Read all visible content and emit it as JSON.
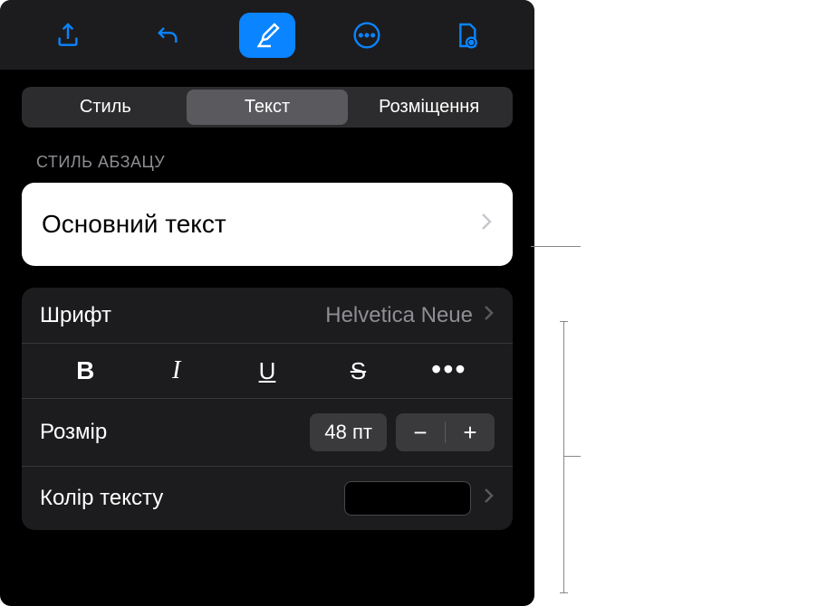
{
  "toolbar": {
    "icons": [
      "share",
      "undo",
      "format",
      "more",
      "document"
    ]
  },
  "tabs": {
    "style": "Стиль",
    "text": "Текст",
    "layout": "Розміщення"
  },
  "section": {
    "paragraph_style_label": "СТИЛЬ АБЗАЦУ",
    "paragraph_style_value": "Основний текст"
  },
  "font": {
    "label": "Шрифт",
    "value": "Helvetica Neue"
  },
  "styles": {
    "bold": "B",
    "italic": "I",
    "underline": "U",
    "strike": "S"
  },
  "size": {
    "label": "Розмір",
    "value": "48 пт",
    "minus": "−",
    "plus": "+"
  },
  "color": {
    "label": "Колір тексту",
    "swatch": "#000000"
  }
}
